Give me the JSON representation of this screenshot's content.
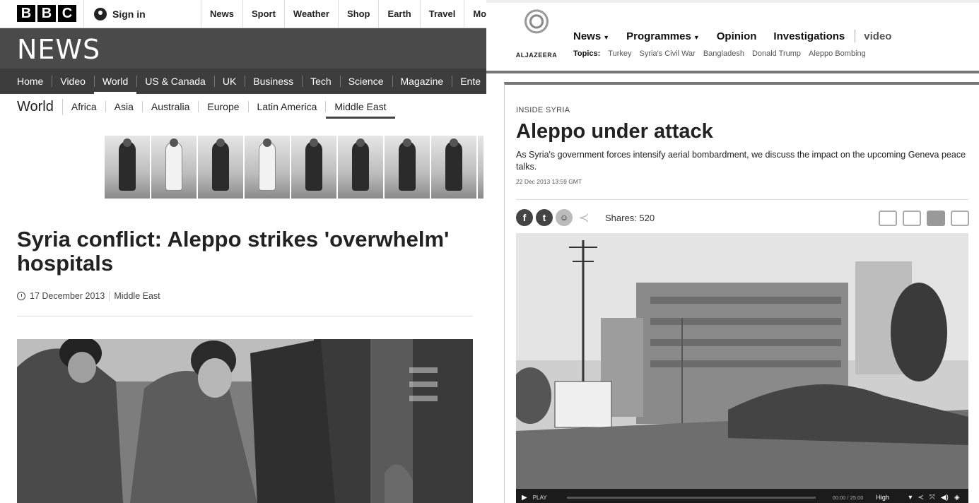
{
  "bbc": {
    "logo_letters": [
      "B",
      "B",
      "C"
    ],
    "signin_label": "Sign in",
    "top_nav": [
      "News",
      "Sport",
      "Weather",
      "Shop",
      "Earth",
      "Travel",
      "Mo"
    ],
    "section_title": "NEWS",
    "main_nav": [
      "Home",
      "Video",
      "World",
      "US & Canada",
      "UK",
      "Business",
      "Tech",
      "Science",
      "Magazine",
      "Ente"
    ],
    "main_nav_active": "World",
    "sub_nav_title": "World",
    "sub_nav": [
      "Africa",
      "Asia",
      "Australia",
      "Europe",
      "Latin America",
      "Middle East"
    ],
    "sub_nav_active": "Middle East",
    "headline": "Syria conflict: Aleppo strikes 'overwhelm' hospitals",
    "date": "17 December 2013",
    "category": "Middle East"
  },
  "aljazeera": {
    "logo_text": "ALJAZEERA",
    "nav": {
      "news": "News",
      "programmes": "Programmes",
      "opinion": "Opinion",
      "investigations": "Investigations",
      "video": "video"
    },
    "topics_label": "Topics:",
    "topics": [
      "Turkey",
      "Syria's Civil War",
      "Bangladesh",
      "Donald Trump",
      "Aleppo Bombing"
    ],
    "kicker": "INSIDE SYRIA",
    "title": "Aleppo under attack",
    "dek": "As Syria's government forces intensify aerial bombardment, we discuss the impact on the upcoming Geneva peace talks.",
    "timestamp": "22 Dec 2013 13:59 GMT",
    "shares": "Shares: 520",
    "video": {
      "play_label": "PLAY",
      "time": "00:00 / 25:00",
      "quality": "High"
    }
  },
  "icons": [
    "avatar-icon",
    "clock-icon",
    "facebook-icon",
    "twitter-icon",
    "reddit-icon",
    "share-icon",
    "email-icon",
    "print-icon",
    "comment-icon",
    "feedback-icon",
    "play-icon",
    "fullscreen-icon",
    "volume-icon"
  ]
}
